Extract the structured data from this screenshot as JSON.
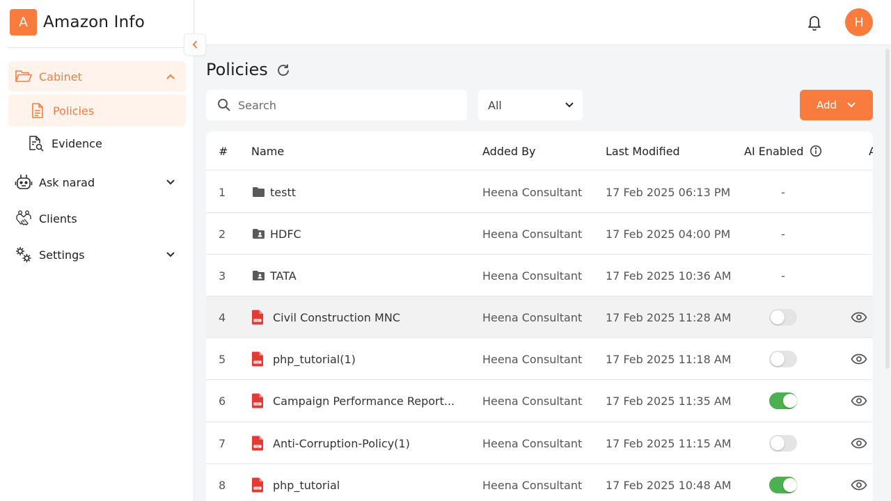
{
  "brand": {
    "logo_letter": "A",
    "name": "Amazon Info"
  },
  "colors": {
    "accent": "#f97b3d",
    "toggle_on": "#4caf50",
    "pdf_red": "#e53935"
  },
  "sidebar": {
    "items": [
      {
        "label": "Cabinet",
        "icon": "folder-open-icon",
        "expanded": true
      },
      {
        "label": "Policies",
        "icon": "document-icon",
        "active": true
      },
      {
        "label": "Evidence",
        "icon": "document-search-icon"
      },
      {
        "label": "Ask narad",
        "icon": "robot-icon",
        "expanded": false
      },
      {
        "label": "Clients",
        "icon": "handshake-icon"
      },
      {
        "label": "Settings",
        "icon": "gears-icon",
        "expanded": false
      }
    ]
  },
  "header": {
    "avatar_letter": "H",
    "notification_icon": "bell-icon"
  },
  "main": {
    "title": "Policies",
    "search": {
      "placeholder": "Search"
    },
    "filter": {
      "selected": "All"
    },
    "add_label": "Add"
  },
  "table": {
    "columns": [
      "#",
      "Name",
      "Added By",
      "Last Modified",
      "AI Enabled",
      "A"
    ],
    "rows": [
      {
        "num": "1",
        "name": "testt",
        "type": "folder",
        "added_by": "Heena Consultant",
        "modified": "17 Feb 2025 06:13 PM",
        "ai": "-"
      },
      {
        "num": "2",
        "name": "HDFC",
        "type": "shared-folder",
        "added_by": "Heena Consultant",
        "modified": "17 Feb 2025 04:00 PM",
        "ai": "-"
      },
      {
        "num": "3",
        "name": "TATA",
        "type": "shared-folder",
        "added_by": "Heena Consultant",
        "modified": "17 Feb 2025 10:36 AM",
        "ai": "-"
      },
      {
        "num": "4",
        "name": "Civil Construction MNC",
        "type": "pdf",
        "added_by": "Heena Consultant",
        "modified": "17 Feb 2025 11:28 AM",
        "ai_enabled": false
      },
      {
        "num": "5",
        "name": "php_tutorial(1)",
        "type": "pdf",
        "added_by": "Heena Consultant",
        "modified": "17 Feb 2025 11:18 AM",
        "ai_enabled": false
      },
      {
        "num": "6",
        "name": "Campaign Performance Report...",
        "type": "pdf",
        "added_by": "Heena Consultant",
        "modified": "17 Feb 2025 11:35 AM",
        "ai_enabled": true
      },
      {
        "num": "7",
        "name": "Anti-Corruption-Policy(1)",
        "type": "pdf",
        "added_by": "Heena Consultant",
        "modified": "17 Feb 2025 11:15 AM",
        "ai_enabled": false
      },
      {
        "num": "8",
        "name": "php_tutorial",
        "type": "pdf",
        "added_by": "Heena Consultant",
        "modified": "17 Feb 2025 10:48 AM",
        "ai_enabled": true
      }
    ]
  }
}
